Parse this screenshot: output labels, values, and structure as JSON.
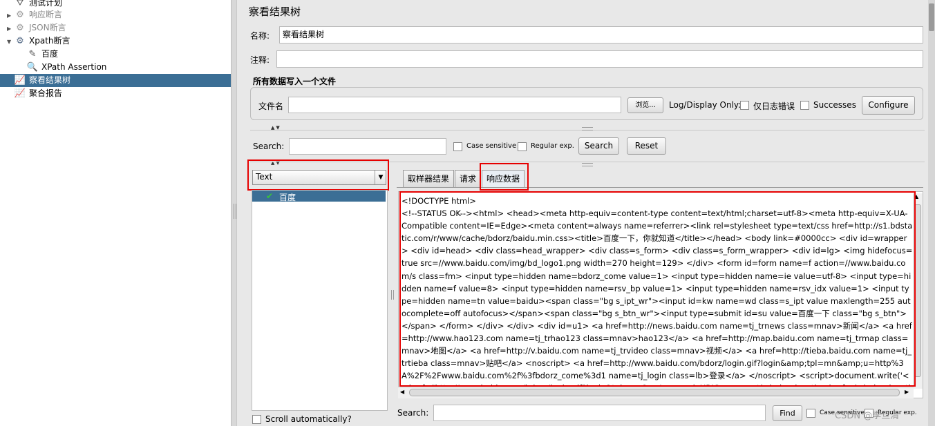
{
  "tree": {
    "items": [
      {
        "label": "测试计划",
        "icon": "test-plan-icon",
        "glyph": "⛛",
        "twisty": "",
        "level": 0,
        "disabled": false,
        "selected": false
      },
      {
        "label": "响应断言",
        "icon": "gear-icon",
        "glyph": "⚙",
        "twisty": "▶",
        "level": 0,
        "disabled": true,
        "selected": false
      },
      {
        "label": "JSON断言",
        "icon": "gear-icon",
        "glyph": "⚙",
        "twisty": "▶",
        "level": 0,
        "disabled": true,
        "selected": false
      },
      {
        "label": "Xpath断言",
        "icon": "gear-icon",
        "glyph": "⚙",
        "twisty": "▼",
        "level": 0,
        "disabled": false,
        "selected": false
      },
      {
        "label": "百度",
        "icon": "http-sampler-icon",
        "glyph": "✎",
        "twisty": "",
        "level": 1,
        "disabled": false,
        "selected": false
      },
      {
        "label": "XPath Assertion",
        "icon": "magnifier-icon",
        "glyph": "🔍",
        "twisty": "",
        "level": 1,
        "disabled": false,
        "selected": false
      },
      {
        "label": "察看结果树",
        "icon": "listener-chart-icon",
        "glyph": "📈",
        "twisty": "",
        "level": 0,
        "disabled": false,
        "selected": true
      },
      {
        "label": "聚合报告",
        "icon": "listener-chart-icon",
        "glyph": "📈",
        "twisty": "",
        "level": 0,
        "disabled": false,
        "selected": false
      }
    ]
  },
  "panel": {
    "title": "察看结果树",
    "name_label": "名称:",
    "name_value": "察看结果树",
    "comment_label": "注释:",
    "comment_value": ""
  },
  "file_section": {
    "title": "所有数据写入一个文件",
    "filename_label": "文件名",
    "filename_value": "",
    "browse_label": "浏览...",
    "log_display_label": "Log/Display Only:",
    "errors_only_label": "仅日志错误",
    "successes_label": "Successes",
    "configure_label": "Configure"
  },
  "search_bar": {
    "label": "Search:",
    "value": "",
    "case_sensitive_label": "Case sensitive",
    "regex_label": "Regular exp.",
    "search_button": "Search",
    "reset_button": "Reset"
  },
  "renderer": {
    "selected": "Text",
    "dropdown_arrow": "▼"
  },
  "results": {
    "items": [
      {
        "label": "百度",
        "status": "success"
      }
    ],
    "scroll_auto_label": "Scroll automatically?"
  },
  "tabs": [
    "取样器结果",
    "请求",
    "响应数据"
  ],
  "active_tab": 2,
  "response": {
    "first_line": "<!DOCTYPE html>",
    "body": "<!--STATUS OK--><html> <head><meta http-equiv=content-type content=text/html;charset=utf-8><meta http-equiv=X-UA-Compatible content=IE=Edge><meta content=always name=referrer><link rel=stylesheet type=text/css href=http://s1.bdstatic.com/r/www/cache/bdorz/baidu.min.css><title>百度一下，你就知道</title></head> <body link=#0000cc> <div id=wrapper> <div id=head> <div class=head_wrapper> <div class=s_form> <div class=s_form_wrapper> <div id=lg> <img hidefocus=true src=//www.baidu.com/img/bd_logo1.png width=270 height=129> </div> <form id=form name=f action=//www.baidu.com/s class=fm> <input type=hidden name=bdorz_come value=1> <input type=hidden name=ie value=utf-8> <input type=hidden name=f value=8> <input type=hidden name=rsv_bp value=1> <input type=hidden name=rsv_idx value=1> <input type=hidden name=tn value=baidu><span class=\"bg s_ipt_wr\"><input id=kw name=wd class=s_ipt value maxlength=255 autocomplete=off autofocus></span><span class=\"bg s_btn_wr\"><input type=submit id=su value=百度一下 class=\"bg s_btn\"></span> </form> </div> </div> <div id=u1> <a href=http://news.baidu.com name=tj_trnews class=mnav>新闻</a> <a href=http://www.hao123.com name=tj_trhao123 class=mnav>hao123</a> <a href=http://map.baidu.com name=tj_trmap class=mnav>地图</a> <a href=http://v.baidu.com name=tj_trvideo class=mnav>视频</a> <a href=http://tieba.baidu.com name=tj_trtieba class=mnav>贴吧</a> <noscript> <a href=http://www.baidu.com/bdorz/login.gif?login&amp;tpl=mn&amp;u=http%3A%2F%2Fwww.baidu.com%2f%3fbdorz_come%3d1 name=tj_login class=lb>登录</a> </noscript> <script>document.write('<a href=\"http://www.baidu.com/bdorz/login.gif?login&tpl=mn&u='+ encodeURIComponent(window.location.href+ (window.location.search === \"\" ? \"?\" : \"&\")+ \"bdorz_come=1\")+ '\" name=\"tj_login\" class=\"lb\">登录</a>');"
  },
  "bottom_search": {
    "label": "Search:",
    "value": "",
    "find_button": "Find",
    "case_sensitive_label": "Case sensitive",
    "regex_label": "Regular exp."
  },
  "watermark": "CSDN @李旦清"
}
